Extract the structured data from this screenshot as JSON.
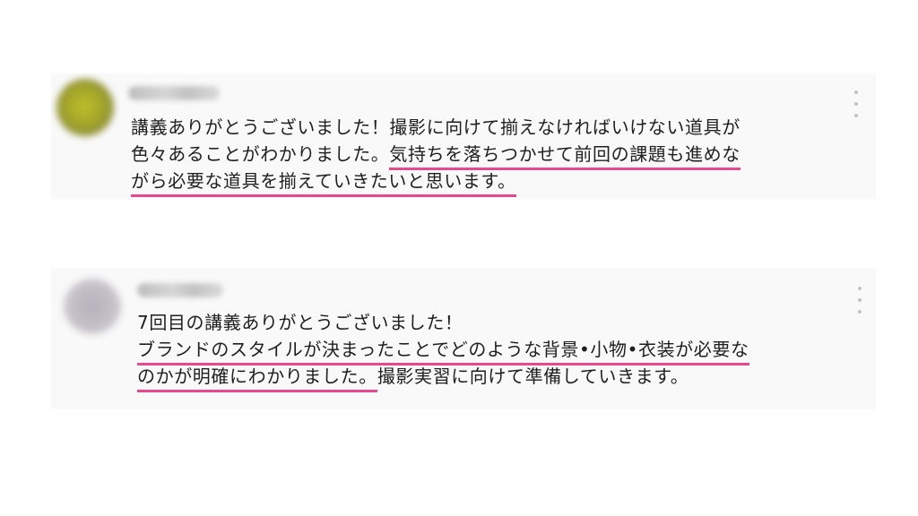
{
  "comments": [
    {
      "lines": [
        "講義ありがとうございました！撮影に向けて揃えなければいけない道具が",
        "色々あることがわかりました。",
        "気持ちを落ちつかせて前回の課題も進めな",
        "がら必要な道具を揃えていきたいと思います。"
      ]
    },
    {
      "lines": [
        "7回目の講義ありがとうございました！",
        "ブランドのスタイルが決まったことでどのような背景•小物•衣装が必要な",
        "のかが明確にわかりました。",
        "撮影実習に向けて準備していきます。"
      ]
    }
  ],
  "colors": {
    "highlight_underline": "#e6498c",
    "card_background": "#f9f9f9",
    "text": "#1f1f1f"
  },
  "icons": {
    "menu": "more-vertical-icon"
  }
}
